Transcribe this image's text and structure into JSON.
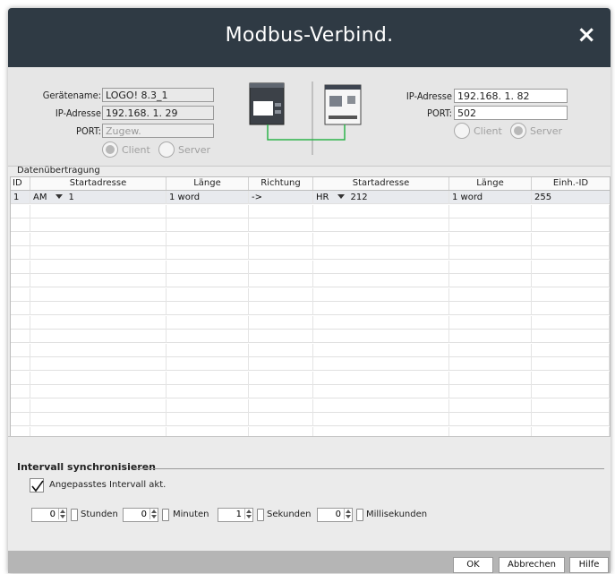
{
  "title": "Modbus-Verbind.",
  "close_glyph": "×",
  "local": {
    "name_label": "Gerätename:",
    "name_value": "LOGO! 8.3_1",
    "ip_label": "IP-Adresse",
    "ip_value": "192.168.  1. 29",
    "port_label": "PORT:",
    "port_placeholder": "Zugew.",
    "client_label": "Client",
    "server_label": "Server",
    "selected_mode": "Client"
  },
  "remote": {
    "ip_label": "IP-Adresse",
    "ip_value": "192.168.  1. 82",
    "port_label": "PORT:",
    "port_value": "502",
    "client_label": "Client",
    "server_label": "Server",
    "selected_mode": "Server"
  },
  "transfer_label": "Datenübertragung",
  "table": {
    "headers": [
      "ID",
      "Startadresse",
      "Länge",
      "Richtung",
      "Startadresse",
      "Länge",
      "Einh.-ID"
    ],
    "rows": [
      {
        "id": "1",
        "local_type": "AM",
        "local_addr": "1",
        "length": "1 word",
        "direction": "->",
        "remote_type": "HR",
        "remote_addr": "212",
        "remote_length": "1 word",
        "unit_id": "255"
      }
    ]
  },
  "interval": {
    "title": "Intervall synchronisieren",
    "checkbox_label": "Angepasstes Intervall akt.",
    "checked": true,
    "hours": "0",
    "hours_label": "Stunden",
    "minutes": "0",
    "minutes_label": "Minuten",
    "seconds": "1",
    "seconds_label": "Sekunden",
    "ms": "0",
    "ms_label": "Millisekunden"
  },
  "buttons": {
    "ok": "OK",
    "cancel": "Abbrechen",
    "help": "Hilfe"
  }
}
